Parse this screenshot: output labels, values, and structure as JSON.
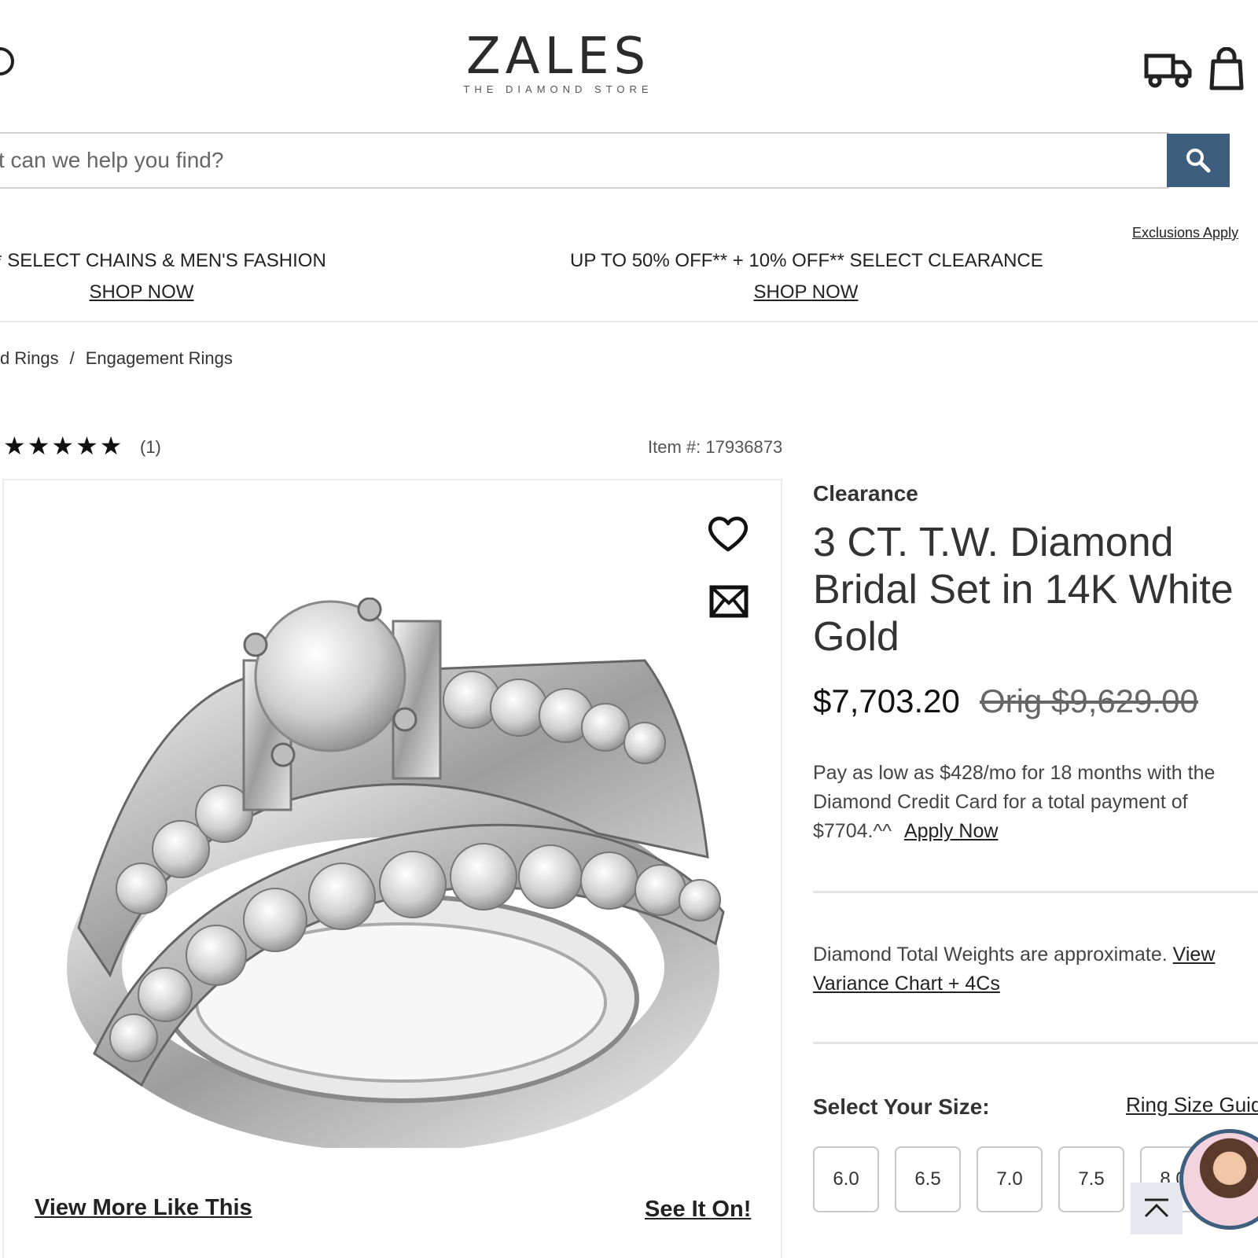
{
  "header": {
    "logo_word": "ZALES",
    "logo_tagline": "THE DIAMOND STORE"
  },
  "search": {
    "placeholder": "t can we help you find?"
  },
  "promos": {
    "exclusions": "Exclusions Apply",
    "items": [
      {
        "text": "OFF* SELECT CHAINS & MEN'S FASHION",
        "link": "SHOP NOW"
      },
      {
        "text": "UP TO 50% OFF** + 10% OFF** SELECT CLEARANCE",
        "link": "SHOP NOW"
      }
    ]
  },
  "breadcrumb": {
    "items": [
      "d Rings",
      "Engagement Rings"
    ],
    "separator": "/"
  },
  "rating": {
    "stars": "★★★★★",
    "value": 5,
    "count": "(1)"
  },
  "item_number": "Item #: 17936873",
  "product": {
    "badge": "Clearance",
    "title": "3 CT. T.W. Diamond Bridal Set in 14K White Gold",
    "price": "$7,703.20",
    "orig_price": "Orig $9,629.00",
    "finance_text": "Pay as low as $428/mo for 18 months with the Diamond Credit Card for a total payment of $7704.^^",
    "finance_link": "Apply Now",
    "weights_text": "Diamond Total Weights are approximate.",
    "weights_link": "View Variance Chart + 4Cs"
  },
  "image_panel": {
    "view_more": "View More Like This",
    "see_it_on": "See It On!"
  },
  "sizes": {
    "label": "Select Your Size:",
    "guide": "Ring Size Guide",
    "options": [
      "6.0",
      "6.5",
      "7.0",
      "7.5",
      "8.0"
    ]
  },
  "icons": {
    "header": [
      "account-icon",
      "truck-icon",
      "bag-icon"
    ],
    "search": "search-icon",
    "image": [
      "heart-icon",
      "mail-icon"
    ],
    "scroll": "chevron-up-icon"
  },
  "colors": {
    "accent": "#3d5f7d",
    "text": "#222222"
  }
}
